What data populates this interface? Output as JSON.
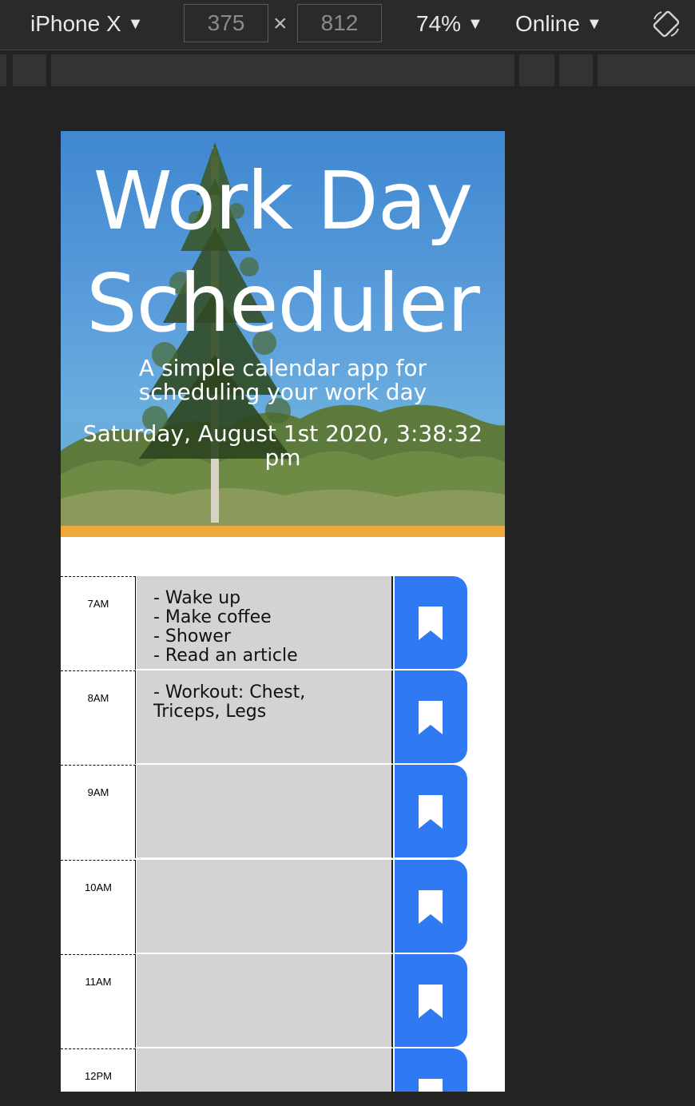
{
  "devtools": {
    "device": "iPhone X",
    "width": "375",
    "height": "812",
    "times_sign": "×",
    "zoom": "74%",
    "network": "Online",
    "dropdown_arrow": "▼",
    "rotate_icon": "rotate-icon"
  },
  "hero": {
    "title": "Work Day Scheduler",
    "lead": "A simple calendar app for scheduling your work day",
    "current_datetime": "Saturday, August 1st 2020, 3:38:32 pm"
  },
  "colors": {
    "accent_bar": "#f0a83a",
    "save_button": "#2f7af2",
    "past_block": "#d3d3d3"
  },
  "time_blocks": [
    {
      "hour": "7AM",
      "text": "- Wake up\n- Make coffee\n- Shower\n- Read an article",
      "save_icon": "bookmark-icon"
    },
    {
      "hour": "8AM",
      "text": "- Workout: Chest,\nTriceps, Legs",
      "save_icon": "bookmark-icon"
    },
    {
      "hour": "9AM",
      "text": "",
      "save_icon": "bookmark-icon"
    },
    {
      "hour": "10AM",
      "text": "",
      "save_icon": "bookmark-icon"
    },
    {
      "hour": "11AM",
      "text": "",
      "save_icon": "bookmark-icon"
    },
    {
      "hour": "12PM",
      "text": "",
      "save_icon": "bookmark-icon"
    }
  ]
}
